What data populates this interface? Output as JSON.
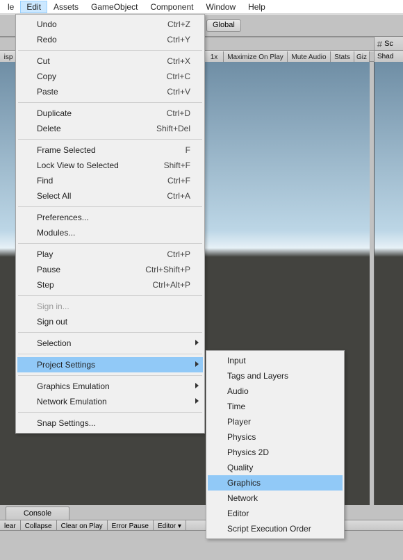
{
  "menubar": {
    "items": [
      "le",
      "Edit",
      "Assets",
      "GameObject",
      "Component",
      "Window",
      "Help"
    ],
    "active_index": 1
  },
  "toolbar": {
    "global_button": "Global",
    "disp_label": "isp",
    "scale_label": "1x",
    "max_on_play": "Maximize On Play",
    "mute_audio": "Mute Audio",
    "stats": "Stats",
    "giz": "Giz",
    "scene_tab": "Sc",
    "shad": "Shad"
  },
  "edit_menu": {
    "g1": [
      {
        "label": "Undo",
        "shortcut": "Ctrl+Z"
      },
      {
        "label": "Redo",
        "shortcut": "Ctrl+Y"
      }
    ],
    "g2": [
      {
        "label": "Cut",
        "shortcut": "Ctrl+X"
      },
      {
        "label": "Copy",
        "shortcut": "Ctrl+C"
      },
      {
        "label": "Paste",
        "shortcut": "Ctrl+V"
      }
    ],
    "g3": [
      {
        "label": "Duplicate",
        "shortcut": "Ctrl+D"
      },
      {
        "label": "Delete",
        "shortcut": "Shift+Del"
      }
    ],
    "g4": [
      {
        "label": "Frame Selected",
        "shortcut": "F"
      },
      {
        "label": "Lock View to Selected",
        "shortcut": "Shift+F"
      },
      {
        "label": "Find",
        "shortcut": "Ctrl+F"
      },
      {
        "label": "Select All",
        "shortcut": "Ctrl+A"
      }
    ],
    "g5": [
      {
        "label": "Preferences...",
        "shortcut": ""
      },
      {
        "label": "Modules...",
        "shortcut": ""
      }
    ],
    "g6": [
      {
        "label": "Play",
        "shortcut": "Ctrl+P"
      },
      {
        "label": "Pause",
        "shortcut": "Ctrl+Shift+P"
      },
      {
        "label": "Step",
        "shortcut": "Ctrl+Alt+P"
      }
    ],
    "g7": [
      {
        "label": "Sign in...",
        "shortcut": "",
        "disabled": true
      },
      {
        "label": "Sign out",
        "shortcut": ""
      }
    ],
    "g8": [
      {
        "label": "Selection",
        "arrow": true
      }
    ],
    "g9": [
      {
        "label": "Project Settings",
        "arrow": true,
        "highlight": true
      }
    ],
    "g10": [
      {
        "label": "Graphics Emulation",
        "arrow": true
      },
      {
        "label": "Network Emulation",
        "arrow": true
      }
    ],
    "g11": [
      {
        "label": "Snap Settings...",
        "shortcut": ""
      }
    ]
  },
  "project_settings_submenu": [
    {
      "label": "Input"
    },
    {
      "label": "Tags and Layers"
    },
    {
      "label": "Audio"
    },
    {
      "label": "Time"
    },
    {
      "label": "Player"
    },
    {
      "label": "Physics"
    },
    {
      "label": "Physics 2D"
    },
    {
      "label": "Quality"
    },
    {
      "label": "Graphics",
      "highlight": true
    },
    {
      "label": "Network"
    },
    {
      "label": "Editor"
    },
    {
      "label": "Script Execution Order"
    }
  ],
  "console": {
    "tab": "Console",
    "buttons": [
      "lear",
      "Collapse",
      "Clear on Play",
      "Error Pause",
      "Editor ▾"
    ]
  }
}
